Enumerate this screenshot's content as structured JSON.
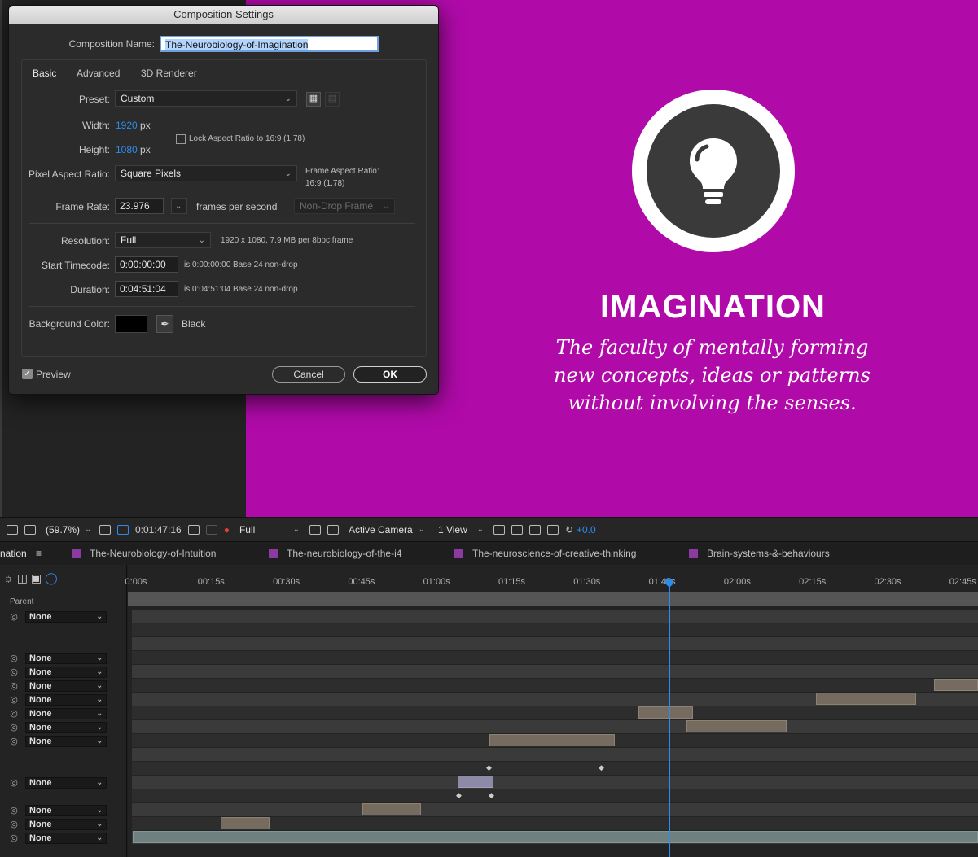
{
  "dialog": {
    "title": "Composition Settings",
    "comp_name_label": "Composition Name:",
    "comp_name_value": "The-Neurobiology-of-Imagination",
    "tabs": [
      "Basic",
      "Advanced",
      "3D Renderer"
    ],
    "preset_label": "Preset:",
    "preset_value": "Custom",
    "width_label": "Width:",
    "width_value": "1920",
    "height_label": "Height:",
    "height_value": "1080",
    "px_unit": "px",
    "lock_aspect_label": "Lock Aspect Ratio to 16:9 (1.78)",
    "pixel_aspect_label": "Pixel Aspect Ratio:",
    "pixel_aspect_value": "Square Pixels",
    "frame_aspect_label": "Frame Aspect Ratio:",
    "frame_aspect_value": "16:9 (1.78)",
    "frame_rate_label": "Frame Rate:",
    "frame_rate_value": "23.976",
    "frame_rate_unit": "frames per second",
    "drop_frame_value": "Non-Drop Frame",
    "resolution_label": "Resolution:",
    "resolution_value": "Full",
    "resolution_info": "1920 x 1080, 7.9 MB per 8bpc frame",
    "start_tc_label": "Start Timecode:",
    "start_tc_value": "0:00:00:00",
    "start_tc_info": "is 0:00:00:00  Base 24  non-drop",
    "duration_label": "Duration:",
    "duration_value": "0:04:51:04",
    "duration_info": "is 0:04:51:04  Base 24  non-drop",
    "bg_color_label": "Background Color:",
    "bg_color_name": "Black",
    "bg_color": "#000000",
    "preview_label": "Preview",
    "cancel_label": "Cancel",
    "ok_label": "OK"
  },
  "viewer": {
    "background": "#b00aa9",
    "title": "IMAGINATION",
    "lines": [
      "The faculty of mentally forming",
      "new concepts, ideas or patterns",
      "without involving the senses."
    ]
  },
  "viewer_bar": {
    "zoom": "(59.7%)",
    "timecode": "0:01:47:16",
    "resolution": "Full",
    "camera": "Active Camera",
    "views": "1 View",
    "exposure": "+0.0"
  },
  "tabs": {
    "active": "nation",
    "others": [
      "The-Neurobiology-of-Intuition",
      "The-neurobiology-of-the-i4",
      "The-neuroscience-of-creative-thinking",
      "Brain-systems-&-behaviours"
    ]
  },
  "timeline": {
    "parent_header": "Parent",
    "parent_value": "None",
    "ruler": [
      "0:00s",
      "00:15s",
      "00:30s",
      "00:45s",
      "01:00s",
      "01:15s",
      "01:30s",
      "01:45s",
      "02:00s",
      "02:15s",
      "02:30s",
      "02:45s"
    ]
  }
}
